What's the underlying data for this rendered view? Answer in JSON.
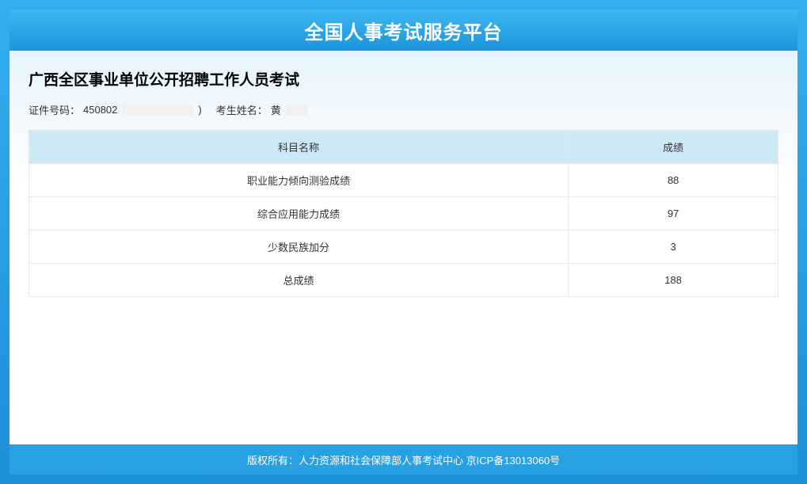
{
  "header": {
    "title": "全国人事考试服务平台"
  },
  "exam": {
    "title": "广西全区事业单位公开招聘工作人员考试",
    "id_label": "证件号码：",
    "id_value_prefix": "450802",
    "id_value_suffix": ")",
    "name_label": "考生姓名：",
    "name_value": "黄"
  },
  "table": {
    "header_subject": "科目名称",
    "header_score": "成绩",
    "rows": [
      {
        "subject": "职业能力倾向测验成绩",
        "score": "88"
      },
      {
        "subject": "综合应用能力成绩",
        "score": "97"
      },
      {
        "subject": "少数民族加分",
        "score": "3"
      },
      {
        "subject": "总成绩",
        "score": "188"
      }
    ]
  },
  "footer": {
    "copyright": "版权所有：人力资源和社会保障部人事考试中心 京ICP备13013060号"
  }
}
